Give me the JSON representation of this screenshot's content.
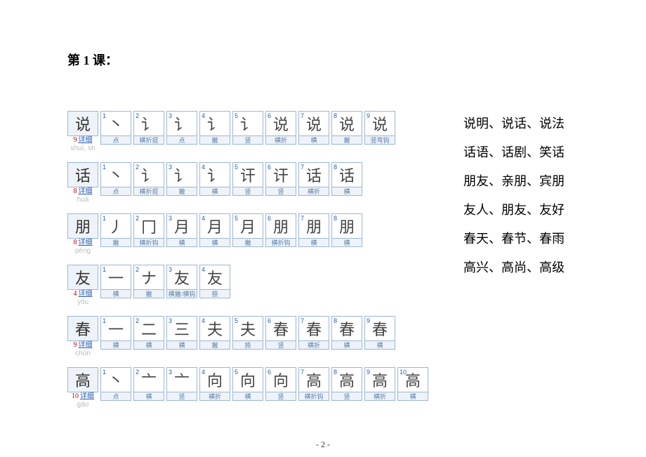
{
  "heading": "第 1 课：",
  "footer": "- 2 -",
  "link_label": "详细",
  "characters": [
    {
      "glyph": "说",
      "count": 9,
      "pinyin": "shuì, sh",
      "strokes": [
        {
          "n": 1,
          "g": "丶",
          "label": "点"
        },
        {
          "n": 2,
          "g": "讠",
          "label": "横折提"
        },
        {
          "n": 3,
          "g": "讠",
          "label": "点"
        },
        {
          "n": 4,
          "g": "讠",
          "label": "撇"
        },
        {
          "n": 5,
          "g": "讠",
          "label": "竖"
        },
        {
          "n": 6,
          "g": "说",
          "label": "横折"
        },
        {
          "n": 7,
          "g": "说",
          "label": "横"
        },
        {
          "n": 8,
          "g": "说",
          "label": "撇"
        },
        {
          "n": 9,
          "g": "说",
          "label": "竖弯钩"
        }
      ]
    },
    {
      "glyph": "话",
      "count": 8,
      "pinyin": "huà",
      "strokes": [
        {
          "n": 1,
          "g": "丶",
          "label": "点"
        },
        {
          "n": 2,
          "g": "讠",
          "label": "横折提"
        },
        {
          "n": 3,
          "g": "讠",
          "label": "撇"
        },
        {
          "n": 4,
          "g": "讠",
          "label": "横"
        },
        {
          "n": 5,
          "g": "讦",
          "label": "竖"
        },
        {
          "n": 6,
          "g": "讦",
          "label": "竖"
        },
        {
          "n": 7,
          "g": "话",
          "label": "横折"
        },
        {
          "n": 8,
          "g": "话",
          "label": "横"
        }
      ]
    },
    {
      "glyph": "朋",
      "count": 8,
      "pinyin": "péng",
      "strokes": [
        {
          "n": 1,
          "g": "丿",
          "label": "撇"
        },
        {
          "n": 2,
          "g": "冂",
          "label": "横折钩"
        },
        {
          "n": 3,
          "g": "月",
          "label": "横"
        },
        {
          "n": 4,
          "g": "月",
          "label": "横"
        },
        {
          "n": 5,
          "g": "月",
          "label": "撇"
        },
        {
          "n": 6,
          "g": "朋",
          "label": "横折钩"
        },
        {
          "n": 7,
          "g": "朋",
          "label": "横"
        },
        {
          "n": 8,
          "g": "朋",
          "label": "横"
        }
      ]
    },
    {
      "glyph": "友",
      "count": 4,
      "pinyin": "yǒu",
      "strokes": [
        {
          "n": 1,
          "g": "一",
          "label": "横"
        },
        {
          "n": 2,
          "g": "ナ",
          "label": "撇"
        },
        {
          "n": 3,
          "g": "友",
          "label": "横撇/横钩"
        },
        {
          "n": 4,
          "g": "友",
          "label": "捺"
        }
      ]
    },
    {
      "glyph": "春",
      "count": 9,
      "pinyin": "chūn",
      "strokes": [
        {
          "n": 1,
          "g": "一",
          "label": "横"
        },
        {
          "n": 2,
          "g": "二",
          "label": "横"
        },
        {
          "n": 3,
          "g": "三",
          "label": "横"
        },
        {
          "n": 4,
          "g": "夫",
          "label": "撇"
        },
        {
          "n": 5,
          "g": "夫",
          "label": "捺"
        },
        {
          "n": 6,
          "g": "春",
          "label": "竖"
        },
        {
          "n": 7,
          "g": "春",
          "label": "横折"
        },
        {
          "n": 8,
          "g": "春",
          "label": "横"
        },
        {
          "n": 9,
          "g": "春",
          "label": "横"
        }
      ]
    },
    {
      "glyph": "高",
      "count": 10,
      "pinyin": "gāo",
      "strokes": [
        {
          "n": 1,
          "g": "丶",
          "label": "点"
        },
        {
          "n": 2,
          "g": "亠",
          "label": "横"
        },
        {
          "n": 3,
          "g": "亠",
          "label": "竖"
        },
        {
          "n": 4,
          "g": "向",
          "label": "横折"
        },
        {
          "n": 5,
          "g": "向",
          "label": "横"
        },
        {
          "n": 6,
          "g": "向",
          "label": "竖"
        },
        {
          "n": 7,
          "g": "高",
          "label": "横折钩"
        },
        {
          "n": 8,
          "g": "高",
          "label": "竖"
        },
        {
          "n": 9,
          "g": "高",
          "label": "横折"
        },
        {
          "n": 10,
          "g": "高",
          "label": "横"
        }
      ]
    }
  ],
  "vocab_lines": [
    "说明、说话、说法",
    "话语、话剧、笑话",
    "朋友、亲朋、宾朋",
    "友人、朋友、友好",
    "春天、春节、春雨",
    "高兴、高尚、高级"
  ]
}
